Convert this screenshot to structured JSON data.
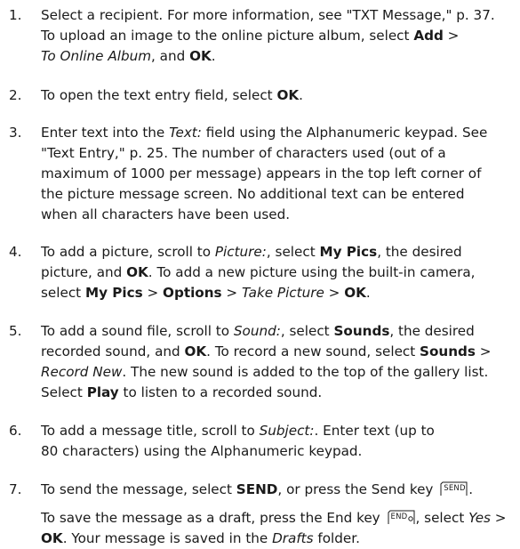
{
  "steps": [
    {
      "number": "1.",
      "text": [
        "Select a recipient. For more information, see \"TXT Message,\" p. 37.",
        "To upload an image to the online picture album, select ",
        "Add",
        " >",
        "To Online Album",
        ", and ",
        "OK",
        "."
      ]
    },
    {
      "number": "2.",
      "text": [
        "To open the text entry field, select ",
        "OK",
        "."
      ]
    },
    {
      "number": "3.",
      "text": [
        "Enter text into the ",
        "Text:",
        " field using the Alphanumeric keypad. See",
        "\"Text Entry,\" p. 25. The number of characters used (out of a",
        "maximum of 1000 per message) appears in the top left corner of",
        "the picture message screen. No additional text can be entered",
        "when all characters have been used."
      ]
    },
    {
      "number": "4.",
      "text": [
        "To add a picture, scroll to ",
        "Picture:",
        ", select ",
        "My Pics",
        ", the desired",
        "picture, and ",
        "OK",
        ". To add a new picture using the built-in camera,",
        "select ",
        "My Pics",
        " > ",
        "Options",
        " > ",
        "Take Picture",
        " > ",
        "OK",
        "."
      ]
    },
    {
      "number": "5.",
      "text": [
        "To add a sound file, scroll to ",
        "Sound:",
        ", select ",
        "Sounds",
        ", the desired",
        "recorded sound, and ",
        "OK",
        ". To record a new sound, select ",
        "Sounds",
        " >",
        "Record New",
        ". The new sound is added to the top of the gallery list.",
        "Select ",
        "Play",
        " to listen to a recorded sound."
      ]
    },
    {
      "number": "6.",
      "text": [
        "To add a message title, scroll to ",
        "Subject:",
        ". Enter text (up to",
        "80 characters) using the Alphanumeric keypad."
      ]
    },
    {
      "number": "7.",
      "text": [
        "To send the message, select ",
        "SEND",
        ", or press the Send key ",
        "."
      ],
      "draft_text": [
        "To save the message as a draft, press the End key ",
        ", select ",
        "Yes",
        " >",
        "OK",
        ". Your message is saved in the ",
        "Drafts",
        " folder."
      ]
    }
  ],
  "keys": {
    "send": "SEND",
    "end": "END"
  }
}
